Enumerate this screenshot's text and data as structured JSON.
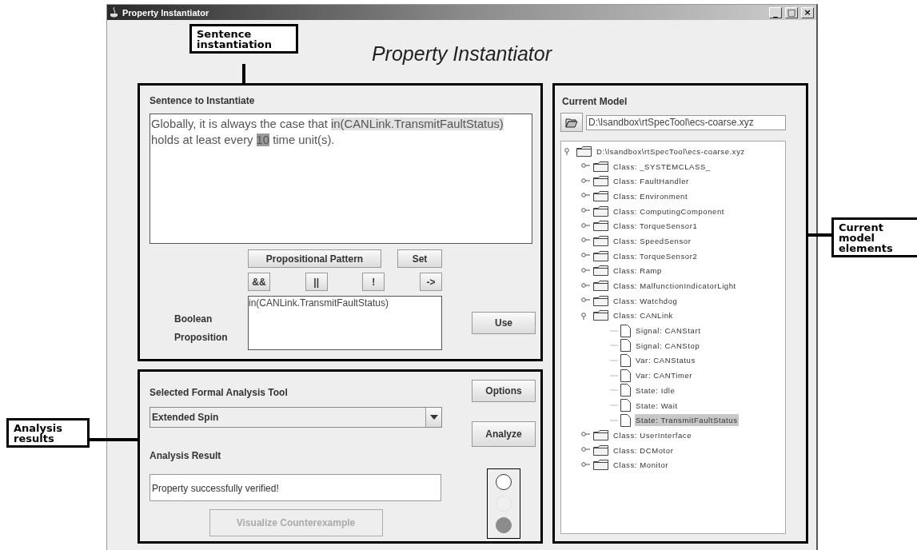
{
  "window": {
    "title": "Property Instantiator",
    "controls": [
      "_",
      "□",
      "×"
    ]
  },
  "app_title": "Property Instantiator",
  "sentence_panel": {
    "label": "Sentence to Instantiate",
    "segments": [
      {
        "text": "Globally, it is always the case that ",
        "kind": "plain"
      },
      {
        "text": "in(CANLink.TransmitFaultStatus)",
        "kind": "proposition"
      },
      {
        "text": " holds at least every ",
        "kind": "plain"
      },
      {
        "text": "10",
        "kind": "number"
      },
      {
        "text": " time unit(s).",
        "kind": "plain"
      }
    ],
    "pattern_button": "Propositional Pattern",
    "set_button": "Set",
    "operators": [
      "&&",
      "||",
      "!",
      "->"
    ],
    "proposition_label": [
      "Boolean",
      "Proposition"
    ],
    "proposition_value": "in(CANLink.TransmitFaultStatus)",
    "use_button": "Use"
  },
  "analysis_panel": {
    "tool_label": "Selected Formal Analysis Tool",
    "tool_value": "Extended Spin",
    "options_button": "Options",
    "analyze_button": "Analyze",
    "result_label": "Analysis Result",
    "result_value": "Property successfully verified!",
    "visualize_button": {
      "label": "Visualize Counterexample",
      "disabled": true
    },
    "lights": [
      {
        "kind": "ring"
      },
      {
        "kind": "dim"
      },
      {
        "kind": "solid"
      }
    ]
  },
  "model_panel": {
    "label": "Current Model",
    "path": "D:\\lsandbox\\rtSpecTool\\ecs-coarse.xyz",
    "tree": [
      {
        "label": "D:\\lsandbox\\rtSpecTool\\ecs-coarse.xyz",
        "kind": "folder",
        "expanded": true,
        "selected": false,
        "children": [
          {
            "label": "Class: _SYSTEMCLASS_",
            "kind": "folder",
            "expanded": false,
            "selected": false
          },
          {
            "label": "Class: FaultHandler",
            "kind": "folder",
            "expanded": false,
            "selected": false
          },
          {
            "label": "Class: Environment",
            "kind": "folder",
            "expanded": false,
            "selected": false
          },
          {
            "label": "Class: ComputingComponent",
            "kind": "folder",
            "expanded": false,
            "selected": false
          },
          {
            "label": "Class: TorqueSensor1",
            "kind": "folder",
            "expanded": false,
            "selected": false
          },
          {
            "label": "Class: SpeedSensor",
            "kind": "folder",
            "expanded": false,
            "selected": false
          },
          {
            "label": "Class: TorqueSensor2",
            "kind": "folder",
            "expanded": false,
            "selected": false
          },
          {
            "label": "Class: Ramp",
            "kind": "folder",
            "expanded": false,
            "selected": false
          },
          {
            "label": "Class: MalfunctionIndicatorLight",
            "kind": "folder",
            "expanded": false,
            "selected": false
          },
          {
            "label": "Class: Watchdog",
            "kind": "folder",
            "expanded": false,
            "selected": false
          },
          {
            "label": "Class: CANLink",
            "kind": "folder",
            "expanded": true,
            "selected": false,
            "children": [
              {
                "label": "Signal: CANStart",
                "kind": "file",
                "selected": false
              },
              {
                "label": "Signal: CANStop",
                "kind": "file",
                "selected": false
              },
              {
                "label": "Var: CANStatus",
                "kind": "file",
                "selected": false
              },
              {
                "label": "Var: CANTimer",
                "kind": "file",
                "selected": false
              },
              {
                "label": "State: Idle",
                "kind": "file",
                "selected": false
              },
              {
                "label": "State: Wait",
                "kind": "file",
                "selected": false
              },
              {
                "label": "State: TransmitFaultStatus",
                "kind": "file",
                "selected": true
              }
            ]
          },
          {
            "label": "Class: UserInterface",
            "kind": "folder",
            "expanded": false,
            "selected": false
          },
          {
            "label": "Class: DCMotor",
            "kind": "folder",
            "expanded": false,
            "selected": false
          },
          {
            "label": "Class: Monitor",
            "kind": "folder",
            "expanded": false,
            "selected": false
          }
        ]
      }
    ]
  },
  "callouts": [
    "Sentence instantiation",
    "Analysis results",
    "Current model elements"
  ]
}
